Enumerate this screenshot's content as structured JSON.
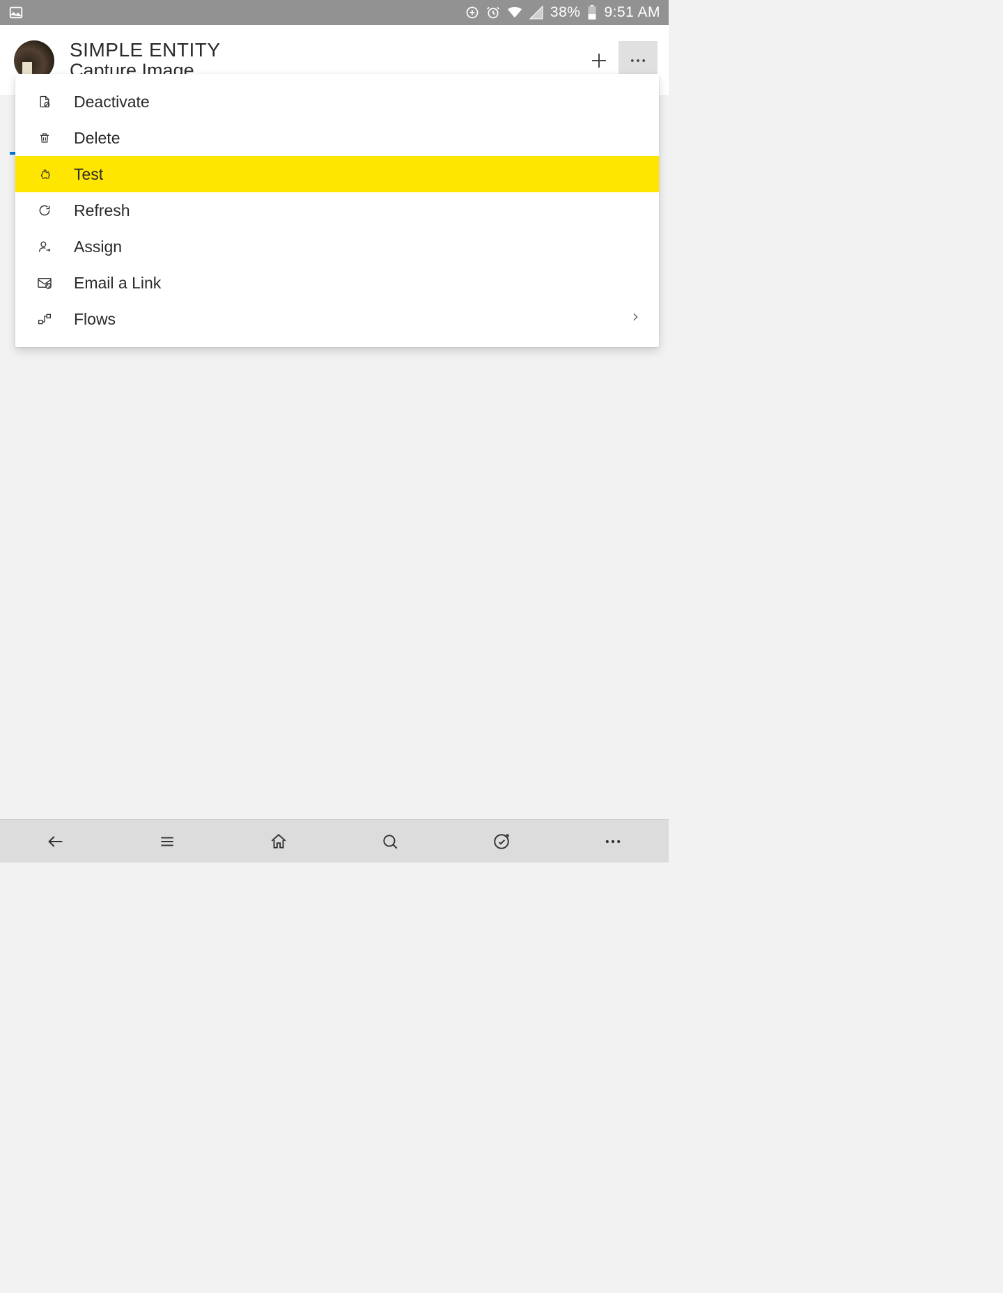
{
  "status_bar": {
    "battery_percent": "38%",
    "time": "9:51 AM"
  },
  "header": {
    "title": "SIMPLE ENTITY",
    "subtitle": "Capture Image"
  },
  "menu": {
    "items": [
      {
        "icon": "deactivate-icon",
        "label": "Deactivate",
        "highlight": false,
        "has_submenu": false
      },
      {
        "icon": "trash-icon",
        "label": "Delete",
        "highlight": false,
        "has_submenu": false
      },
      {
        "icon": "puzzle-icon",
        "label": "Test",
        "highlight": true,
        "has_submenu": false
      },
      {
        "icon": "refresh-icon",
        "label": "Refresh",
        "highlight": false,
        "has_submenu": false
      },
      {
        "icon": "assign-icon",
        "label": "Assign",
        "highlight": false,
        "has_submenu": false
      },
      {
        "icon": "mail-link-icon",
        "label": "Email a Link",
        "highlight": false,
        "has_submenu": false
      },
      {
        "icon": "flow-icon",
        "label": "Flows",
        "highlight": false,
        "has_submenu": true
      }
    ]
  }
}
